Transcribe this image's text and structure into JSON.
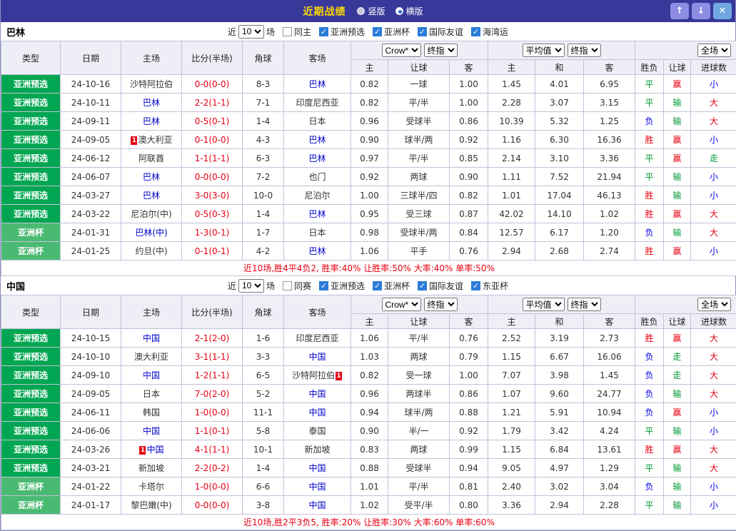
{
  "titlebar": {
    "title": "近期战绩",
    "view_options": [
      {
        "label": "竖版",
        "selected": false
      },
      {
        "label": "横版",
        "selected": true
      }
    ],
    "buttons": {
      "up": "↑",
      "down": "↓",
      "close": "✕"
    }
  },
  "marks": {
    "red_card": "1"
  },
  "colors": {
    "titlebar_bg": "#38389a",
    "title_text": "#ffd800",
    "type_badge_qualifier": "#00a651",
    "type_badge_asiancup": "#4aba72",
    "focus_team": "#0000cc",
    "score": "#e60012",
    "win_red": "#e60012",
    "draw_green": "#009933",
    "lose_blue": "#0000e6",
    "checkbox_blue": "#2b7bd9",
    "header_bg": "#eeeef6"
  },
  "table_headers": {
    "main": [
      "类型",
      "日期",
      "主场",
      "比分(半场)",
      "角球",
      "客场"
    ],
    "group1": {
      "select1": "Crow*",
      "select2": "终指",
      "sub": [
        "主",
        "让球",
        "客"
      ]
    },
    "group2": {
      "select1": "平均值",
      "select2": "终指",
      "sub": [
        "主",
        "和",
        "客"
      ]
    },
    "group3": {
      "select1": "全场",
      "sub": [
        "胜负",
        "让球",
        "进球数"
      ]
    }
  },
  "sections": [
    {
      "team": "巴林",
      "filter": {
        "prefix": "近",
        "count": "10",
        "suffix": "场",
        "unchecked": "同主",
        "checked": [
          "亚洲预选",
          "亚洲杯",
          "国际友谊",
          "海湾运"
        ]
      },
      "rows": [
        {
          "type": "亚洲预选",
          "tc": "g1",
          "date": "24-10-16",
          "home": "沙特阿拉伯",
          "hf": false,
          "hm": "",
          "score": "0-0(0-0)",
          "corner": "8-3",
          "away": "巴林",
          "af": true,
          "am": "",
          "h": [
            "0.82",
            "一球",
            "1.00"
          ],
          "avg": [
            "1.45",
            "4.01",
            "6.95"
          ],
          "res": [
            [
              "平",
              "green"
            ],
            [
              "赢",
              "red"
            ],
            [
              "小",
              "blue"
            ]
          ]
        },
        {
          "type": "亚洲预选",
          "tc": "g1",
          "date": "24-10-11",
          "home": "巴林",
          "hf": true,
          "hm": "",
          "score": "2-2(1-1)",
          "corner": "7-1",
          "away": "印度尼西亚",
          "af": false,
          "am": "",
          "h": [
            "0.82",
            "平/半",
            "1.00"
          ],
          "avg": [
            "2.28",
            "3.07",
            "3.15"
          ],
          "res": [
            [
              "平",
              "green"
            ],
            [
              "输",
              "green"
            ],
            [
              "大",
              "red"
            ]
          ]
        },
        {
          "type": "亚洲预选",
          "tc": "g1",
          "date": "24-09-11",
          "home": "巴林",
          "hf": true,
          "hm": "",
          "score": "0-5(0-1)",
          "corner": "1-4",
          "away": "日本",
          "af": false,
          "am": "",
          "h": [
            "0.96",
            "受球半",
            "0.86"
          ],
          "avg": [
            "10.39",
            "5.32",
            "1.25"
          ],
          "res": [
            [
              "负",
              "blue"
            ],
            [
              "输",
              "green"
            ],
            [
              "大",
              "red"
            ]
          ]
        },
        {
          "type": "亚洲预选",
          "tc": "g1",
          "date": "24-09-05",
          "home": "澳大利亚",
          "hf": false,
          "hm": "pre",
          "score": "0-1(0-0)",
          "corner": "4-3",
          "away": "巴林",
          "af": true,
          "am": "",
          "h": [
            "0.90",
            "球半/两",
            "0.92"
          ],
          "avg": [
            "1.16",
            "6.30",
            "16.36"
          ],
          "res": [
            [
              "胜",
              "red"
            ],
            [
              "赢",
              "red"
            ],
            [
              "小",
              "blue"
            ]
          ]
        },
        {
          "type": "亚洲预选",
          "tc": "g1",
          "date": "24-06-12",
          "home": "阿联酋",
          "hf": false,
          "hm": "",
          "score": "1-1(1-1)",
          "corner": "6-3",
          "away": "巴林",
          "af": true,
          "am": "",
          "h": [
            "0.97",
            "平/半",
            "0.85"
          ],
          "avg": [
            "2.14",
            "3.10",
            "3.36"
          ],
          "res": [
            [
              "平",
              "green"
            ],
            [
              "赢",
              "red"
            ],
            [
              "走",
              "green"
            ]
          ]
        },
        {
          "type": "亚洲预选",
          "tc": "g1",
          "date": "24-06-07",
          "home": "巴林",
          "hf": true,
          "hm": "",
          "score": "0-0(0-0)",
          "corner": "7-2",
          "away": "也门",
          "af": false,
          "am": "",
          "h": [
            "0.92",
            "两球",
            "0.90"
          ],
          "avg": [
            "1.11",
            "7.52",
            "21.94"
          ],
          "res": [
            [
              "平",
              "green"
            ],
            [
              "输",
              "green"
            ],
            [
              "小",
              "blue"
            ]
          ]
        },
        {
          "type": "亚洲预选",
          "tc": "g1",
          "date": "24-03-27",
          "home": "巴林",
          "hf": true,
          "hm": "",
          "score": "3-0(3-0)",
          "corner": "10-0",
          "away": "尼泊尔",
          "af": false,
          "am": "",
          "h": [
            "1.00",
            "三球半/四",
            "0.82"
          ],
          "avg": [
            "1.01",
            "17.04",
            "46.13"
          ],
          "res": [
            [
              "胜",
              "red"
            ],
            [
              "输",
              "green"
            ],
            [
              "小",
              "blue"
            ]
          ]
        },
        {
          "type": "亚洲预选",
          "tc": "g1",
          "date": "24-03-22",
          "home": "尼泊尔(中)",
          "hf": false,
          "hm": "",
          "score": "0-5(0-3)",
          "corner": "1-4",
          "away": "巴林",
          "af": true,
          "am": "",
          "h": [
            "0.95",
            "受三球",
            "0.87"
          ],
          "avg": [
            "42.02",
            "14.10",
            "1.02"
          ],
          "res": [
            [
              "胜",
              "red"
            ],
            [
              "赢",
              "red"
            ],
            [
              "大",
              "red"
            ]
          ]
        },
        {
          "type": "亚洲杯",
          "tc": "g2",
          "date": "24-01-31",
          "home": "巴林(中)",
          "hf": true,
          "hm": "",
          "score": "1-3(0-1)",
          "corner": "1-7",
          "away": "日本",
          "af": false,
          "am": "",
          "h": [
            "0.98",
            "受球半/两",
            "0.84"
          ],
          "avg": [
            "12.57",
            "6.17",
            "1.20"
          ],
          "res": [
            [
              "负",
              "blue"
            ],
            [
              "输",
              "green"
            ],
            [
              "大",
              "red"
            ]
          ]
        },
        {
          "type": "亚洲杯",
          "tc": "g2",
          "date": "24-01-25",
          "home": "约旦(中)",
          "hf": false,
          "hm": "",
          "score": "0-1(0-1)",
          "corner": "4-2",
          "away": "巴林",
          "af": true,
          "am": "",
          "h": [
            "1.06",
            "平手",
            "0.76"
          ],
          "avg": [
            "2.94",
            "2.68",
            "2.74"
          ],
          "res": [
            [
              "胜",
              "red"
            ],
            [
              "赢",
              "red"
            ],
            [
              "小",
              "blue"
            ]
          ]
        }
      ],
      "summary": "近10场,胜4平4负2, 胜率:40% 让胜率:50% 大率:40% 单率:50%"
    },
    {
      "team": "中国",
      "filter": {
        "prefix": "近",
        "count": "10",
        "suffix": "场",
        "unchecked": "同赛",
        "checked": [
          "亚洲预选",
          "亚洲杯",
          "国际友谊",
          "东亚杯"
        ]
      },
      "rows": [
        {
          "type": "亚洲预选",
          "tc": "g1",
          "date": "24-10-15",
          "home": "中国",
          "hf": true,
          "hm": "",
          "score": "2-1(2-0)",
          "corner": "1-6",
          "away": "印度尼西亚",
          "af": false,
          "am": "",
          "h": [
            "1.06",
            "平/半",
            "0.76"
          ],
          "avg": [
            "2.52",
            "3.19",
            "2.73"
          ],
          "res": [
            [
              "胜",
              "red"
            ],
            [
              "赢",
              "red"
            ],
            [
              "大",
              "red"
            ]
          ]
        },
        {
          "type": "亚洲预选",
          "tc": "g1",
          "date": "24-10-10",
          "home": "澳大利亚",
          "hf": false,
          "hm": "",
          "score": "3-1(1-1)",
          "corner": "3-3",
          "away": "中国",
          "af": true,
          "am": "",
          "h": [
            "1.03",
            "两球",
            "0.79"
          ],
          "avg": [
            "1.15",
            "6.67",
            "16.06"
          ],
          "res": [
            [
              "负",
              "blue"
            ],
            [
              "走",
              "green"
            ],
            [
              "大",
              "red"
            ]
          ]
        },
        {
          "type": "亚洲预选",
          "tc": "g1",
          "date": "24-09-10",
          "home": "中国",
          "hf": true,
          "hm": "",
          "score": "1-2(1-1)",
          "corner": "6-5",
          "away": "沙特阿拉伯",
          "af": false,
          "am": "post",
          "h": [
            "0.82",
            "受一球",
            "1.00"
          ],
          "avg": [
            "7.07",
            "3.98",
            "1.45"
          ],
          "res": [
            [
              "负",
              "blue"
            ],
            [
              "走",
              "green"
            ],
            [
              "大",
              "red"
            ]
          ]
        },
        {
          "type": "亚洲预选",
          "tc": "g1",
          "date": "24-09-05",
          "home": "日本",
          "hf": false,
          "hm": "",
          "score": "7-0(2-0)",
          "corner": "5-2",
          "away": "中国",
          "af": true,
          "am": "",
          "h": [
            "0.96",
            "两球半",
            "0.86"
          ],
          "avg": [
            "1.07",
            "9.60",
            "24.77"
          ],
          "res": [
            [
              "负",
              "blue"
            ],
            [
              "输",
              "green"
            ],
            [
              "大",
              "red"
            ]
          ]
        },
        {
          "type": "亚洲预选",
          "tc": "g1",
          "date": "24-06-11",
          "home": "韩国",
          "hf": false,
          "hm": "",
          "score": "1-0(0-0)",
          "corner": "11-1",
          "away": "中国",
          "af": true,
          "am": "",
          "h": [
            "0.94",
            "球半/两",
            "0.88"
          ],
          "avg": [
            "1.21",
            "5.91",
            "10.94"
          ],
          "res": [
            [
              "负",
              "blue"
            ],
            [
              "赢",
              "red"
            ],
            [
              "小",
              "blue"
            ]
          ]
        },
        {
          "type": "亚洲预选",
          "tc": "g1",
          "date": "24-06-06",
          "home": "中国",
          "hf": true,
          "hm": "",
          "score": "1-1(0-1)",
          "corner": "5-8",
          "away": "泰国",
          "af": false,
          "am": "",
          "h": [
            "0.90",
            "半/一",
            "0.92"
          ],
          "avg": [
            "1.79",
            "3.42",
            "4.24"
          ],
          "res": [
            [
              "平",
              "green"
            ],
            [
              "输",
              "green"
            ],
            [
              "小",
              "blue"
            ]
          ]
        },
        {
          "type": "亚洲预选",
          "tc": "g1",
          "date": "24-03-26",
          "home": "中国",
          "hf": true,
          "hm": "pre",
          "score": "4-1(1-1)",
          "corner": "10-1",
          "away": "新加坡",
          "af": false,
          "am": "",
          "h": [
            "0.83",
            "两球",
            "0.99"
          ],
          "avg": [
            "1.15",
            "6.84",
            "13.61"
          ],
          "res": [
            [
              "胜",
              "red"
            ],
            [
              "赢",
              "red"
            ],
            [
              "大",
              "red"
            ]
          ]
        },
        {
          "type": "亚洲预选",
          "tc": "g1",
          "date": "24-03-21",
          "home": "新加坡",
          "hf": false,
          "hm": "",
          "score": "2-2(0-2)",
          "corner": "1-4",
          "away": "中国",
          "af": true,
          "am": "",
          "h": [
            "0.88",
            "受球半",
            "0.94"
          ],
          "avg": [
            "9.05",
            "4.97",
            "1.29"
          ],
          "res": [
            [
              "平",
              "green"
            ],
            [
              "输",
              "green"
            ],
            [
              "大",
              "red"
            ]
          ]
        },
        {
          "type": "亚洲杯",
          "tc": "g2",
          "date": "24-01-22",
          "home": "卡塔尔",
          "hf": false,
          "hm": "",
          "score": "1-0(0-0)",
          "corner": "6-6",
          "away": "中国",
          "af": true,
          "am": "",
          "h": [
            "1.01",
            "平/半",
            "0.81"
          ],
          "avg": [
            "2.40",
            "3.02",
            "3.04"
          ],
          "res": [
            [
              "负",
              "blue"
            ],
            [
              "输",
              "green"
            ],
            [
              "小",
              "blue"
            ]
          ]
        },
        {
          "type": "亚洲杯",
          "tc": "g2",
          "date": "24-01-17",
          "home": "黎巴嫩(中)",
          "hf": false,
          "hm": "",
          "score": "0-0(0-0)",
          "corner": "3-8",
          "away": "中国",
          "af": true,
          "am": "",
          "h": [
            "1.02",
            "受平/半",
            "0.80"
          ],
          "avg": [
            "3.36",
            "2.94",
            "2.28"
          ],
          "res": [
            [
              "平",
              "green"
            ],
            [
              "输",
              "green"
            ],
            [
              "小",
              "blue"
            ]
          ]
        }
      ],
      "summary": "近10场,胜2平3负5, 胜率:20% 让胜率:30% 大率:60% 单率:60%"
    }
  ]
}
